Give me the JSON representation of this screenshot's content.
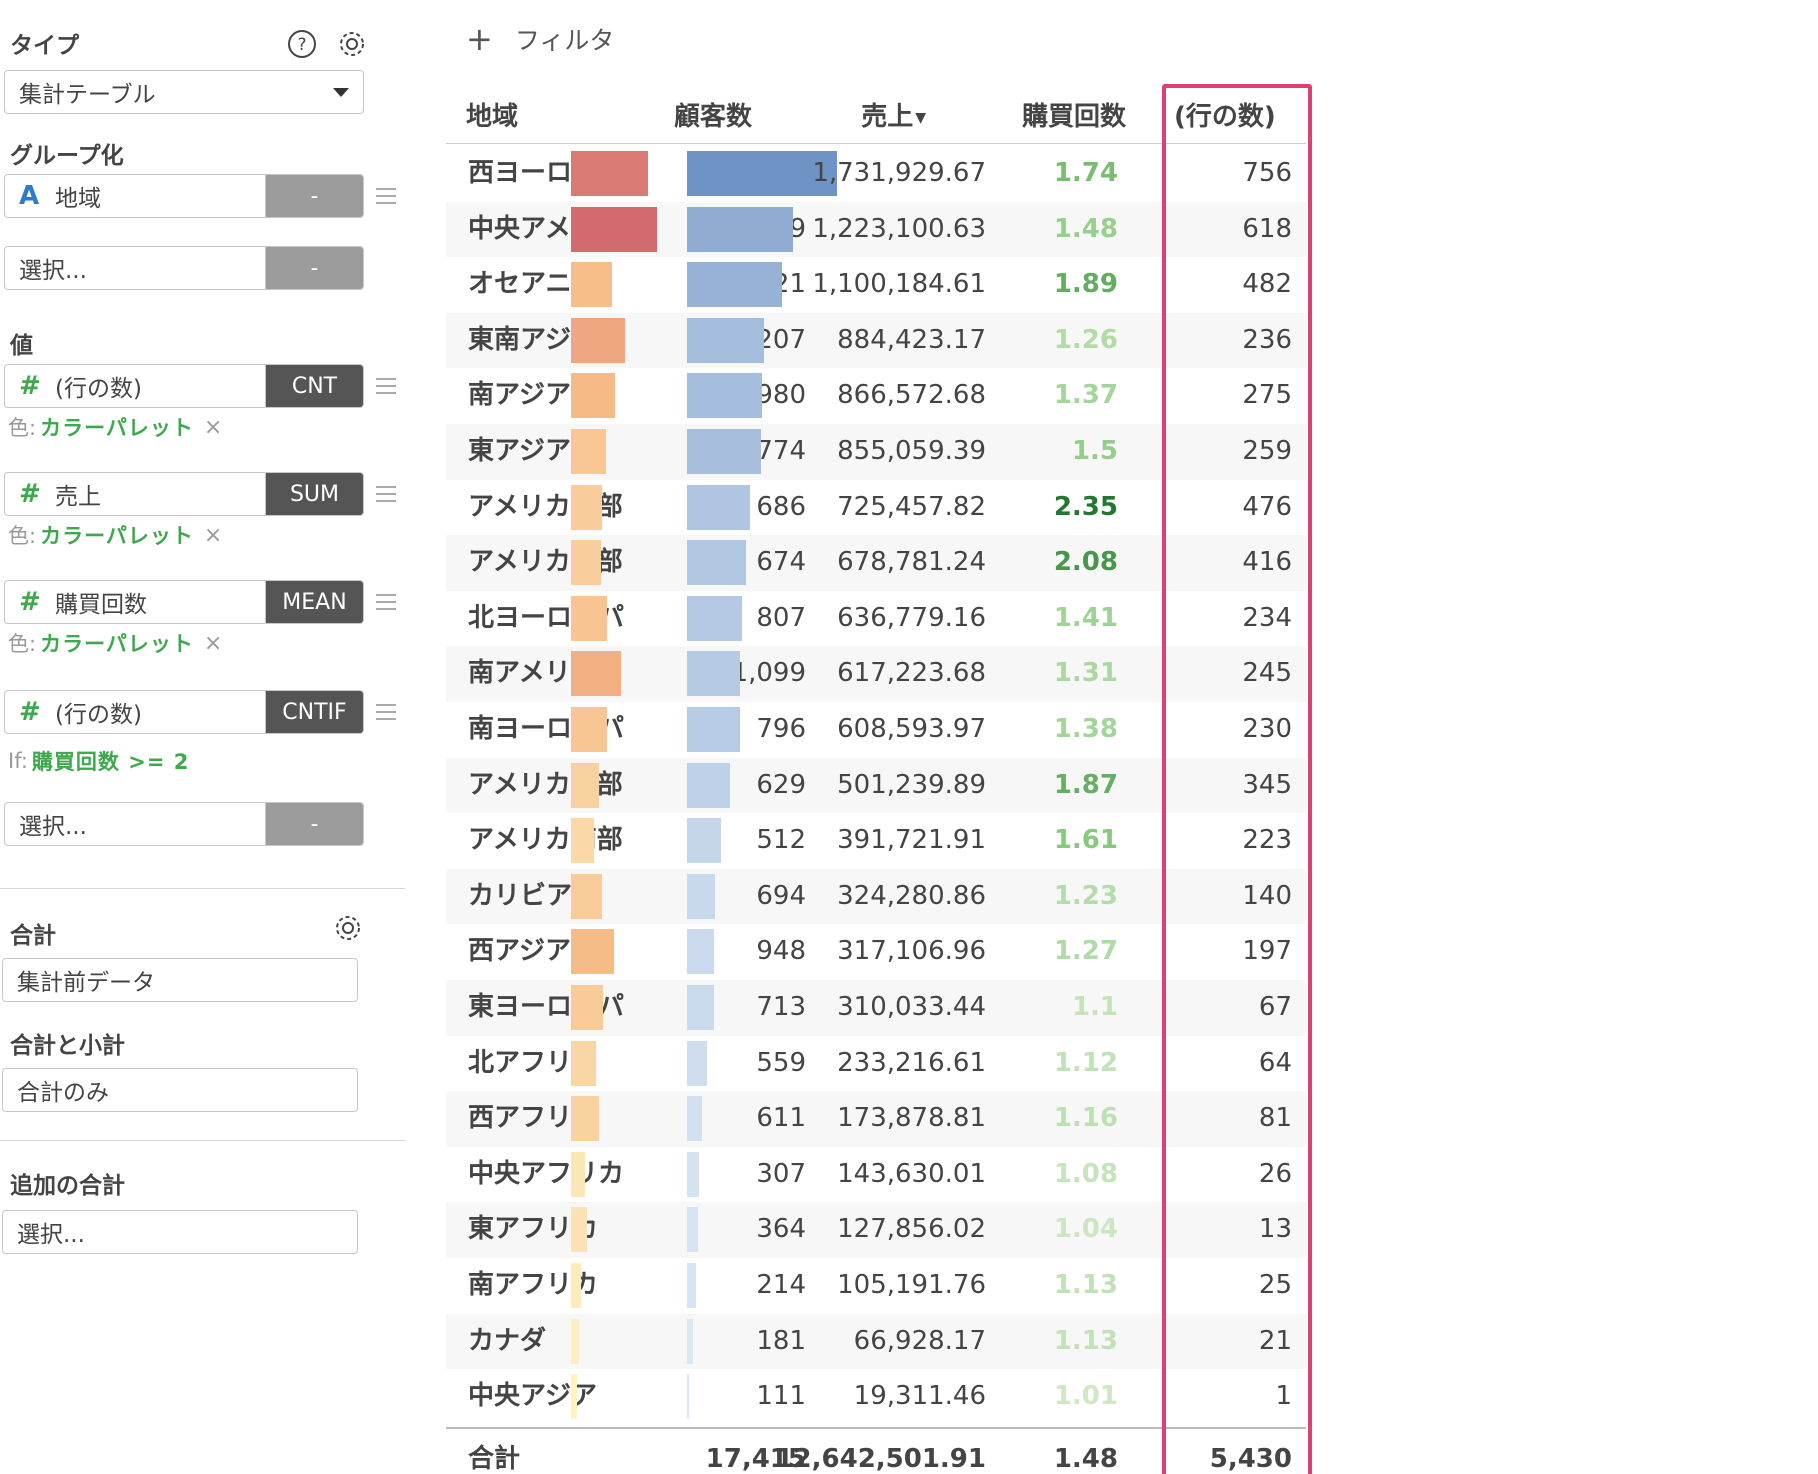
{
  "sidebar": {
    "type_label": "タイプ",
    "type_value": "集計テーブル",
    "group_label": "グループ化",
    "group_field": "地域",
    "group_field_agg": "-",
    "group_select_placeholder": "選択...",
    "group_select_agg": "-",
    "values_label": "値",
    "values": [
      {
        "name": "(行の数)",
        "agg": "CNT",
        "meta_prefix": "色:",
        "meta_value": "カラーパレット",
        "meta_remove": "×"
      },
      {
        "name": "売上",
        "agg": "SUM",
        "meta_prefix": "色:",
        "meta_value": "カラーパレット",
        "meta_remove": "×"
      },
      {
        "name": "購買回数",
        "agg": "MEAN",
        "meta_prefix": "色:",
        "meta_value": "カラーパレット",
        "meta_remove": "×"
      },
      {
        "name": "(行の数)",
        "agg": "CNTIF",
        "meta_prefix": "If:",
        "meta_value": "購買回数 >= 2"
      }
    ],
    "values_select_placeholder": "選択...",
    "values_select_agg": "-",
    "total_label": "合計",
    "total_value": "集計前データ",
    "subtotal_label": "合計と小計",
    "subtotal_value": "合計のみ",
    "extra_total_label": "追加の合計",
    "extra_total_placeholder": "選択..."
  },
  "filter": {
    "plus": "+",
    "label": "フィルタ"
  },
  "table": {
    "headers": {
      "region": "地域",
      "customers": "顧客数",
      "sales": "売上",
      "purchases": "購買回数",
      "rows": "(行の数)"
    },
    "rows": [
      {
        "region": "西ヨーロッパ",
        "customers": "1,719",
        "sales": "1,731,929.67",
        "purchases": "1.74",
        "rows": "756"
      },
      {
        "region": "中央アメリカ",
        "customers": "1,909",
        "sales": "1,223,100.63",
        "purchases": "1.48",
        "rows": "618"
      },
      {
        "region": "オセアニア",
        "customers": "921",
        "sales": "1,100,184.61",
        "purchases": "1.89",
        "rows": "482"
      },
      {
        "region": "東南アジア",
        "customers": "1,207",
        "sales": "884,423.17",
        "purchases": "1.26",
        "rows": "236"
      },
      {
        "region": "南アジア",
        "customers": "980",
        "sales": "866,572.68",
        "purchases": "1.37",
        "rows": "275"
      },
      {
        "region": "東アジア",
        "customers": "774",
        "sales": "855,059.39",
        "purchases": "1.5",
        "rows": "259"
      },
      {
        "region": "アメリカ西部",
        "customers": "686",
        "sales": "725,457.82",
        "purchases": "2.35",
        "rows": "476"
      },
      {
        "region": "アメリカ東部",
        "customers": "674",
        "sales": "678,781.24",
        "purchases": "2.08",
        "rows": "416"
      },
      {
        "region": "北ヨーロッパ",
        "customers": "807",
        "sales": "636,779.16",
        "purchases": "1.41",
        "rows": "234"
      },
      {
        "region": "南アメリカ",
        "customers": "1,099",
        "sales": "617,223.68",
        "purchases": "1.31",
        "rows": "245"
      },
      {
        "region": "南ヨーロッパ",
        "customers": "796",
        "sales": "608,593.97",
        "purchases": "1.38",
        "rows": "230"
      },
      {
        "region": "アメリカ中部",
        "customers": "629",
        "sales": "501,239.89",
        "purchases": "1.87",
        "rows": "345"
      },
      {
        "region": "アメリカ南部",
        "customers": "512",
        "sales": "391,721.91",
        "purchases": "1.61",
        "rows": "223"
      },
      {
        "region": "カリビアン",
        "customers": "694",
        "sales": "324,280.86",
        "purchases": "1.23",
        "rows": "140"
      },
      {
        "region": "西アジア",
        "customers": "948",
        "sales": "317,106.96",
        "purchases": "1.27",
        "rows": "197"
      },
      {
        "region": "東ヨーロッパ",
        "customers": "713",
        "sales": "310,033.44",
        "purchases": "1.1",
        "rows": "67"
      },
      {
        "region": "北アフリカ",
        "customers": "559",
        "sales": "233,216.61",
        "purchases": "1.12",
        "rows": "64"
      },
      {
        "region": "西アフリカ",
        "customers": "611",
        "sales": "173,878.81",
        "purchases": "1.16",
        "rows": "81"
      },
      {
        "region": "中央アフリカ",
        "customers": "307",
        "sales": "143,630.01",
        "purchases": "1.08",
        "rows": "26"
      },
      {
        "region": "東アフリカ",
        "customers": "364",
        "sales": "127,856.02",
        "purchases": "1.04",
        "rows": "13"
      },
      {
        "region": "南アフリカ",
        "customers": "214",
        "sales": "105,191.76",
        "purchases": "1.13",
        "rows": "25"
      },
      {
        "region": "カナダ",
        "customers": "181",
        "sales": "66,928.17",
        "purchases": "1.13",
        "rows": "21"
      },
      {
        "region": "中央アジア",
        "customers": "111",
        "sales": "19,311.46",
        "purchases": "1.01",
        "rows": "1"
      }
    ],
    "totals": {
      "label": "合計",
      "customers": "17,415",
      "sales": "12,642,501.91",
      "purchases": "1.48",
      "rows": "5,430"
    }
  },
  "colors": {
    "accent_green": "#3ea84c",
    "highlight": "#e0406d",
    "sales_bar": "#6f93c4",
    "customers_bar_high": "#d46a6a",
    "customers_bar_low": "#fdf3c4"
  }
}
